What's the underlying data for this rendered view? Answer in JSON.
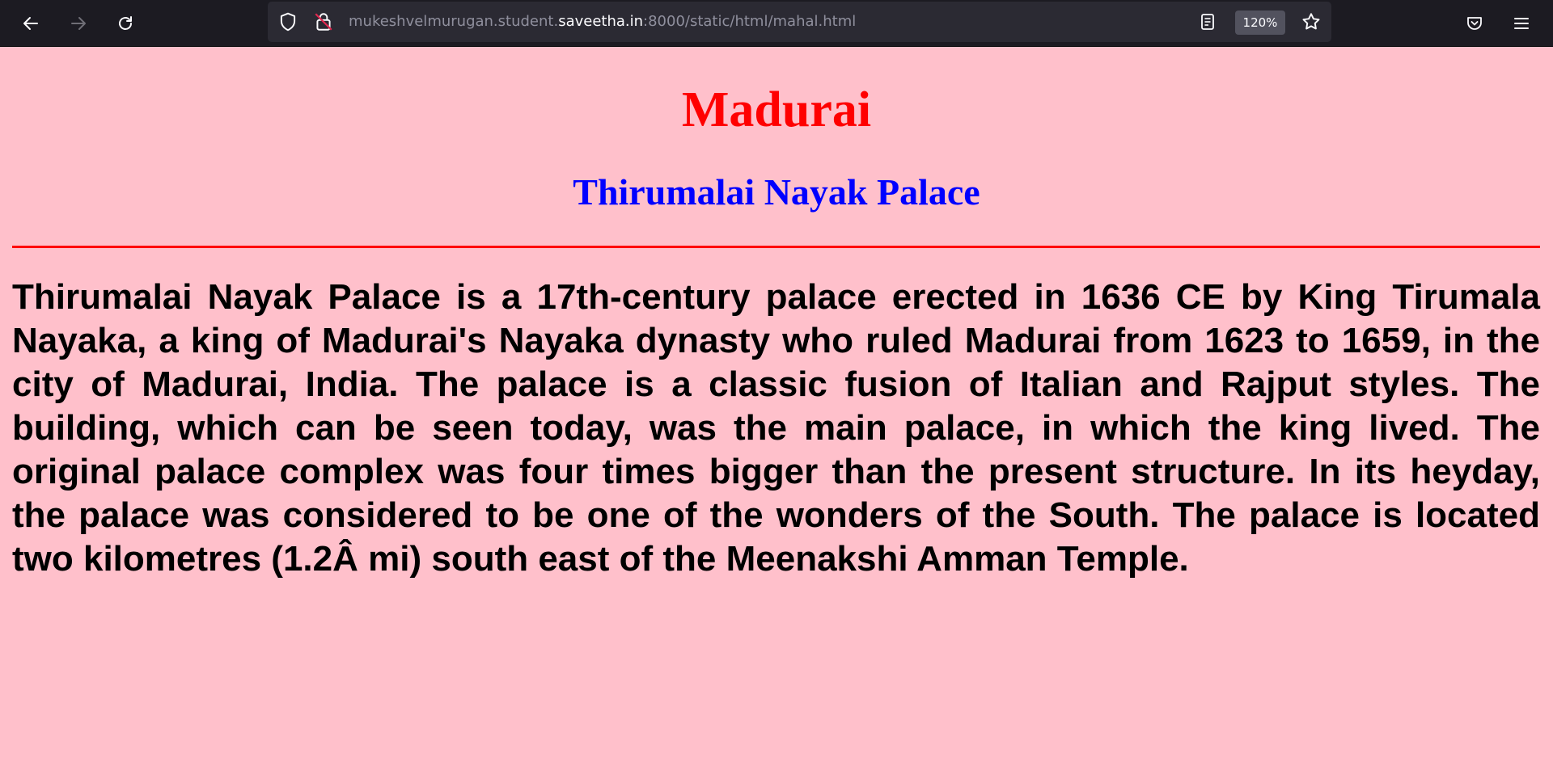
{
  "browser": {
    "url_prefix": "mukeshvelmurugan.student.",
    "url_host": "saveetha.in",
    "url_suffix": ":8000/static/html/mahal.html",
    "zoom": "120%",
    "icons": {
      "back": "back-arrow-icon",
      "forward": "forward-arrow-icon",
      "reload": "reload-icon",
      "shield": "shield-icon",
      "lock": "insecure-lock-icon",
      "reader": "reader-view-icon",
      "bookmark": "star-icon",
      "pocket": "pocket-icon",
      "menu": "hamburger-menu-icon"
    }
  },
  "page": {
    "title": "Madurai",
    "subtitle": "Thirumalai Nayak Palace",
    "paragraph": "Thirumalai Nayak Palace is a 17th-century palace erected in 1636 CE by King Tirumala Nayaka, a king of Madurai's Nayaka dynasty who ruled Madurai from 1623 to 1659, in the city of Madurai, India. The palace is a classic fusion of Italian and Rajput styles. The building, which can be seen today, was the main palace, in which the king lived. The original palace complex was four times bigger than the present structure. In its heyday, the palace was considered to be one of the wonders of the South. The palace is located two kilometres (1.2Â mi) south east of the Meenakshi Amman Temple.",
    "colors": {
      "background": "#ffc0cb",
      "title": "#ff0000",
      "subtitle": "#0000ff",
      "divider": "#ff0000",
      "text": "#000000"
    }
  }
}
